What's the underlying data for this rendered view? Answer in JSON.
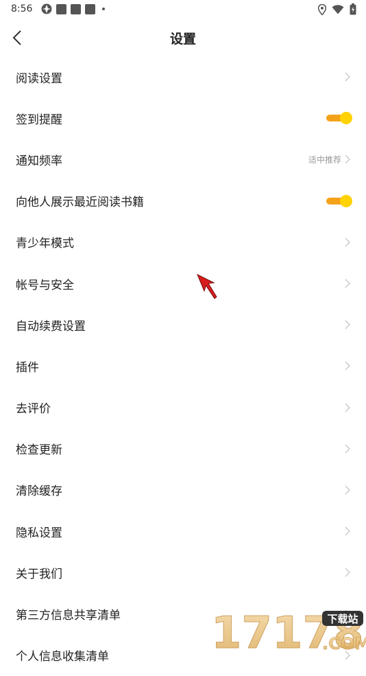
{
  "status_bar": {
    "time": "8:56",
    "left_icons": [
      "app-icon",
      "notification-square",
      "notification-square",
      "notification-square",
      "more-dot"
    ],
    "right_icons": [
      "location-icon",
      "wifi-icon",
      "battery-icon"
    ]
  },
  "header": {
    "title": "设置",
    "back_icon": "chevron-left-icon"
  },
  "settings": {
    "items": [
      {
        "label": "阅读设置",
        "type": "link"
      },
      {
        "label": "签到提醒",
        "type": "toggle",
        "on": true
      },
      {
        "label": "通知频率",
        "type": "link",
        "value": "适中推荐"
      },
      {
        "label": "向他人展示最近阅读书籍",
        "type": "toggle",
        "on": true
      },
      {
        "label": "青少年模式",
        "type": "link"
      },
      {
        "label": "帐号与安全",
        "type": "link"
      },
      {
        "label": "自动续费设置",
        "type": "link"
      },
      {
        "label": "插件",
        "type": "link"
      },
      {
        "label": "去评价",
        "type": "link"
      },
      {
        "label": "检查更新",
        "type": "link"
      },
      {
        "label": "清除缓存",
        "type": "link"
      },
      {
        "label": "隐私设置",
        "type": "link"
      },
      {
        "label": "关于我们",
        "type": "link"
      },
      {
        "label": "第三方信息共享清单",
        "type": "link"
      },
      {
        "label": "个人信息收集清单",
        "type": "link"
      }
    ]
  },
  "watermark": {
    "digits": "17178",
    "badge": "下载站",
    "suffix": ".COM"
  },
  "colors": {
    "toggle_track": "#f5a21b",
    "toggle_knob": "#ffd200",
    "chevron": "#c8c8c8",
    "value_text": "#999999",
    "cursor": "#d81e1e"
  }
}
